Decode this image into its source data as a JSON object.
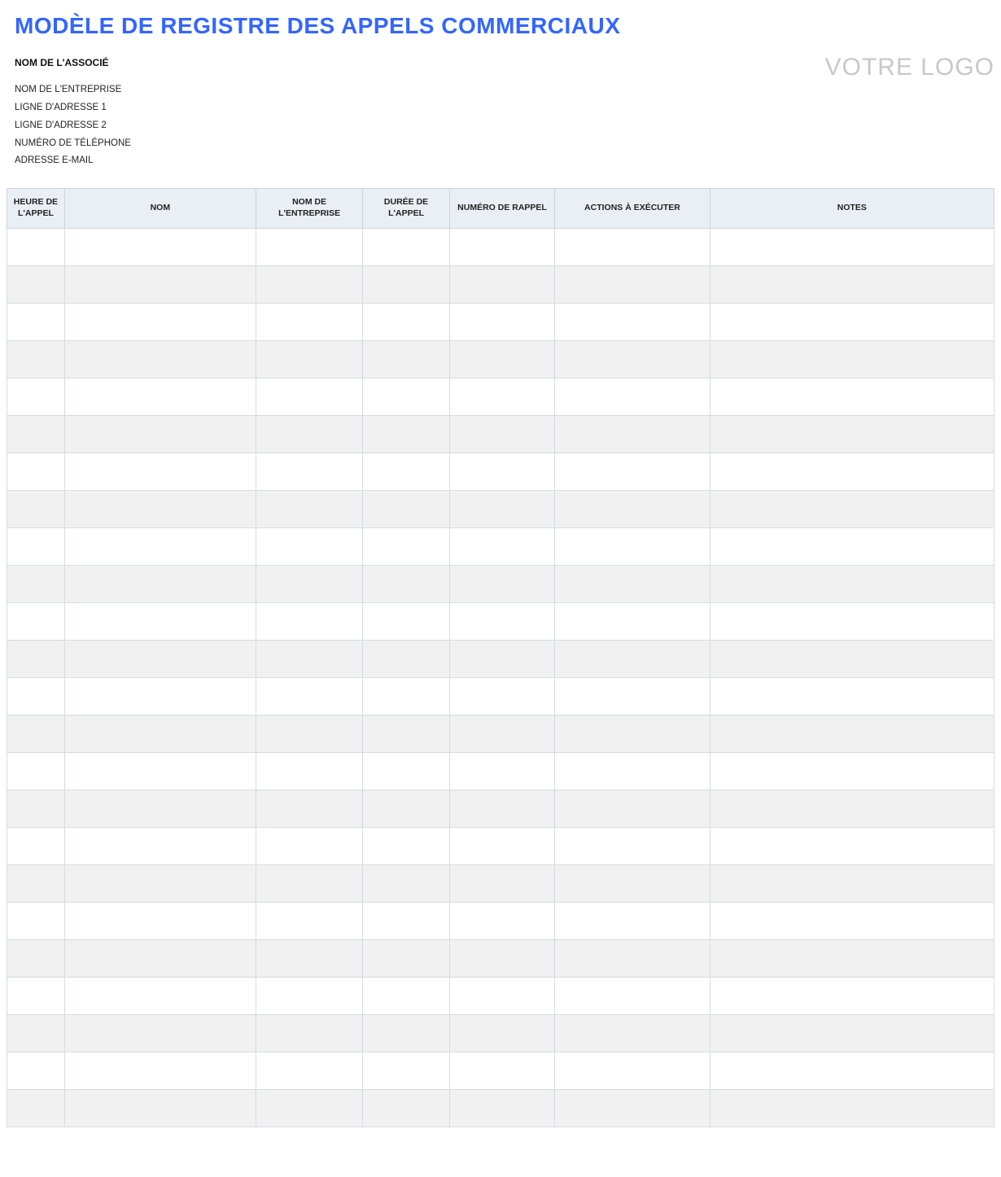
{
  "title": "MODÈLE DE REGISTRE DES APPELS COMMERCIAUX",
  "header": {
    "associate_label": "NOM DE L'ASSOCIÉ",
    "company": "NOM DE L'ENTREPRISE",
    "address1": "LIGNE D'ADRESSE 1",
    "address2": "LIGNE D'ADRESSE 2",
    "phone": "NUMÉRO DE TÉLÉPHONE",
    "email": "ADRESSE E-MAIL",
    "logo_text": "VOTRE LOGO"
  },
  "table": {
    "columns": [
      "HEURE DE L'APPEL",
      "NOM",
      "NOM DE L'ENTREPRISE",
      "DURÉE DE L'APPEL",
      "NUMÉRO DE RAPPEL",
      "ACTIONS À EXÉCUTER",
      "NOTES"
    ],
    "row_count": 24
  }
}
